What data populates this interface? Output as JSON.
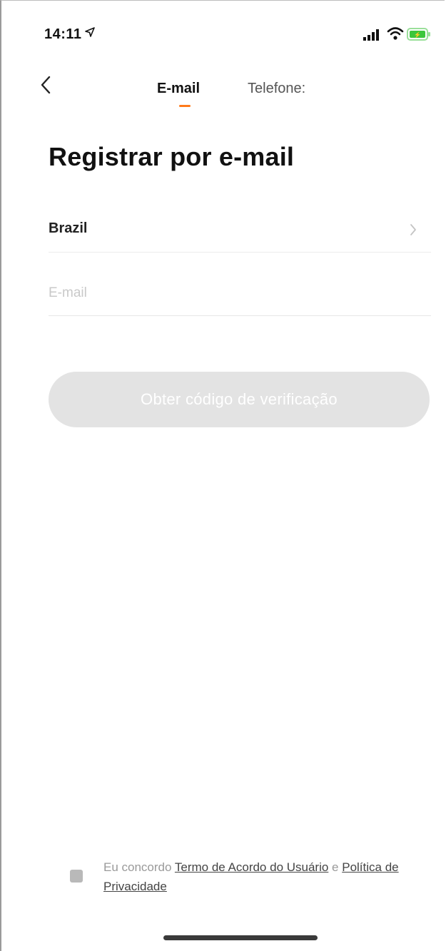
{
  "status_bar": {
    "time": "14:11",
    "icons": [
      "location-arrow-icon",
      "signal-icon",
      "wifi-icon",
      "battery-icon"
    ],
    "battery_color": "#3cc63c"
  },
  "nav": {
    "back_icon": "chevron-left-icon",
    "tabs": [
      {
        "label": "E-mail",
        "active": true
      },
      {
        "label": "Telefone:",
        "active": false
      }
    ],
    "accent_color": "#ff7a1a"
  },
  "page": {
    "title": "Registrar por e-mail"
  },
  "form": {
    "country": "Brazil",
    "country_icon": "chevron-right-icon",
    "email_placeholder": "E-mail",
    "email_value": "",
    "submit_label": "Obter código de verificação",
    "submit_enabled": false
  },
  "agreement": {
    "prefix": "Eu concordo ",
    "terms_link": "Termo de Acordo do Usuário",
    "conjunction": " e ",
    "privacy_link": "Política de Privacidade"
  }
}
